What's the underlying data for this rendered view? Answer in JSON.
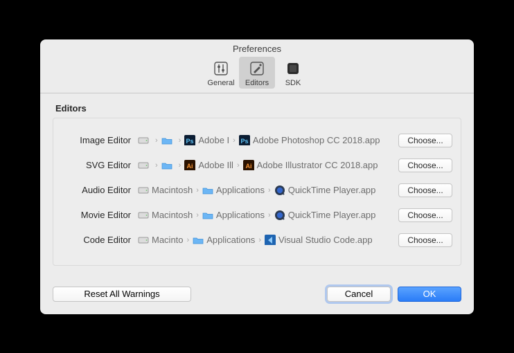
{
  "window": {
    "title": "Preferences"
  },
  "toolbar": {
    "general": "General",
    "editors": "Editors",
    "sdk": "SDK"
  },
  "section": {
    "title": "Editors"
  },
  "choose_label": "Choose...",
  "rows": [
    {
      "label": "Image Editor",
      "segments": [
        {
          "icon": "hd",
          "text": ""
        },
        {
          "icon": "folder",
          "text": ""
        },
        {
          "icon": "app-ps",
          "text": "Adobe  I"
        },
        {
          "icon": "app-ps",
          "text": "Adobe Photoshop CC 2018.app"
        }
      ]
    },
    {
      "label": "SVG Editor",
      "segments": [
        {
          "icon": "hd",
          "text": ""
        },
        {
          "icon": "folder",
          "text": ""
        },
        {
          "icon": "app-ai",
          "text": "Adobe Ill"
        },
        {
          "icon": "app-ai",
          "text": "Adobe Illustrator CC 2018.app"
        }
      ]
    },
    {
      "label": "Audio Editor",
      "segments": [
        {
          "icon": "hd",
          "text": "Macintosh"
        },
        {
          "icon": "folder",
          "text": "Applications"
        },
        {
          "icon": "app-qt",
          "text": "QuickTime Player.app"
        }
      ]
    },
    {
      "label": "Movie Editor",
      "segments": [
        {
          "icon": "hd",
          "text": "Macintosh"
        },
        {
          "icon": "folder",
          "text": "Applications"
        },
        {
          "icon": "app-qt",
          "text": "QuickTime Player.app"
        }
      ]
    },
    {
      "label": "Code Editor",
      "segments": [
        {
          "icon": "hd",
          "text": "Macinto"
        },
        {
          "icon": "folder",
          "text": "Applications"
        },
        {
          "icon": "app-vs",
          "text": "Visual Studio Code.app"
        }
      ]
    }
  ],
  "footer": {
    "reset": "Reset All Warnings",
    "cancel": "Cancel",
    "ok": "OK"
  }
}
